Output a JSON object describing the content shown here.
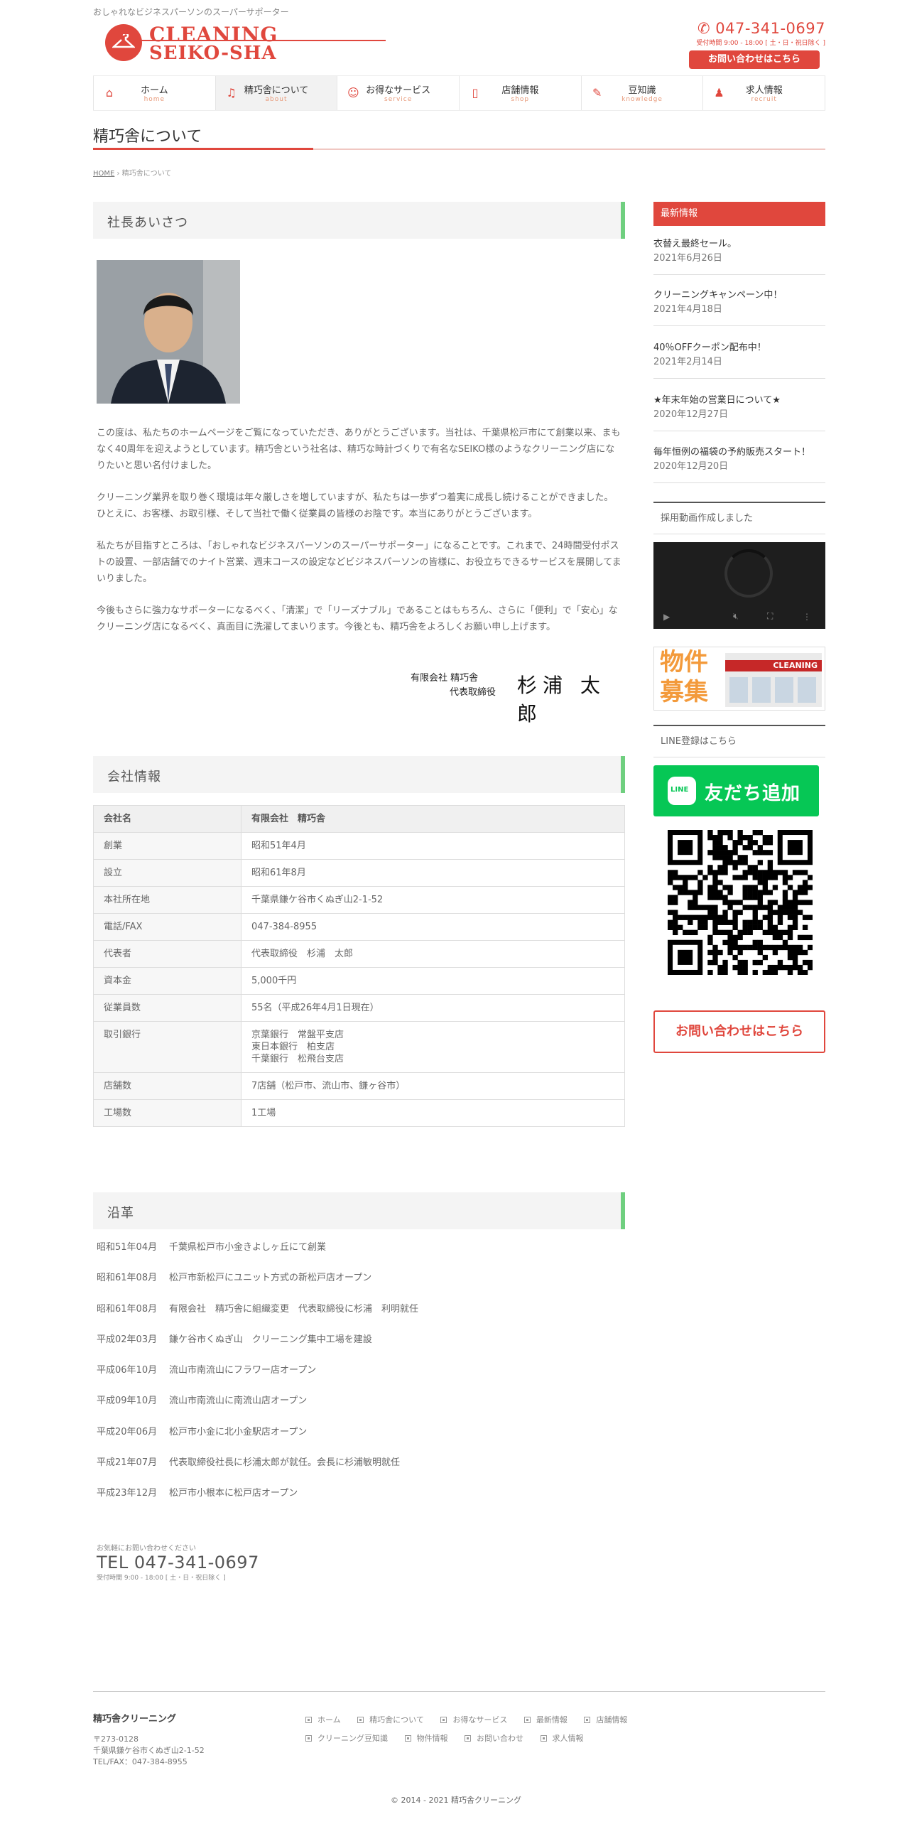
{
  "header": {
    "tagline": "おしゃれなビジネスパーソンのスーパーサポーター",
    "logo_line1": "CLEANING",
    "logo_line2": "SEIKO-SHA",
    "tel": "047-341-0697",
    "hours": "受付時間 9:00 - 18:00 [ 土・日・祝日除く ]",
    "contact_button": "お問い合わせはこちら"
  },
  "nav": {
    "items": [
      {
        "label": "ホーム",
        "sub": "home",
        "icon": "home-icon"
      },
      {
        "label": "精巧舎について",
        "sub": "about",
        "icon": "bell-icon"
      },
      {
        "label": "お得なサービス",
        "sub": "service",
        "icon": "smile-icon"
      },
      {
        "label": "店舗情報",
        "sub": "shop",
        "icon": "building-icon"
      },
      {
        "label": "豆知識",
        "sub": "knowledge",
        "icon": "edit-icon"
      },
      {
        "label": "求人情報",
        "sub": "recruit",
        "icon": "person-icon"
      }
    ]
  },
  "page": {
    "title": "精巧舎について",
    "breadcrumb_home": "HOME",
    "breadcrumb_sep": "›",
    "breadcrumb_current": "精巧舎について"
  },
  "greeting": {
    "heading": "社長あいさつ",
    "p1": "この度は、私たちのホームページをご覧になっていただき、ありがとうございます。当社は、千葉県松戸市にて創業以来、まもなく40周年を迎えようとしています。精巧舎という社名は、精巧な時計づくりで有名なSEIKO様のようなクリーニング店になりたいと思い名付けました。",
    "p2": "クリーニング業界を取り巻く環境は年々厳しさを増していますが、私たちは一歩ずつ着実に成長し続けることができました。ひとえに、お客様、お取引様、そして当社で働く従業員の皆様のお陰です。本当にありがとうございます。",
    "p3": "私たちが目指すところは、「おしゃれなビジネスパーソンのスーパーサポーター」になることです。これまで、24時間受付ポストの設置、一部店舗でのナイト営業、週末コースの設定などビジネスパーソンの皆様に、お役立ちできるサービスを展開してまいりました。",
    "p4": "今後もさらに強力なサポーターになるべく、「清潔」で「リーズナブル」であることはもちろん、さらに「便利」で「安心」なクリーニング店になるべく、真面目に洗濯してまいります。今後とも、精巧舎をよろしくお願い申し上げます。",
    "sig_company": "有限会社 精巧舎",
    "sig_title": "代表取締役",
    "sig_name": "杉浦 太郎"
  },
  "company": {
    "heading": "会社情報",
    "rows": [
      {
        "k": "会社名",
        "v": "有限会社　精巧舎"
      },
      {
        "k": "創業",
        "v": "昭和51年4月"
      },
      {
        "k": "設立",
        "v": "昭和61年8月"
      },
      {
        "k": "本社所在地",
        "v": "千葉県鎌ケ谷市くぬぎ山2-1-52"
      },
      {
        "k": "電話/FAX",
        "v": "047-384-8955"
      },
      {
        "k": "代表者",
        "v": "代表取締役　杉浦　太郎"
      },
      {
        "k": "資本金",
        "v": "5,000千円"
      },
      {
        "k": "従業員数",
        "v": "55名（平成26年4月1日現在）"
      },
      {
        "k": "取引銀行",
        "v1": "京葉銀行　常盤平支店",
        "v2": "東日本銀行　柏支店",
        "v3": "千葉銀行　松飛台支店"
      },
      {
        "k": "店舗数",
        "v": "7店舗（松戸市、流山市、鎌ヶ谷市）"
      },
      {
        "k": "工場数",
        "v": "1工場"
      }
    ]
  },
  "history": {
    "heading": "沿革",
    "items": [
      {
        "d": "昭和51年04月",
        "t": "千葉県松戸市小金きよしヶ丘にて創業"
      },
      {
        "d": "昭和61年08月",
        "t": "松戸市新松戸にユニット方式の新松戸店オープン"
      },
      {
        "d": "昭和61年08月",
        "t": "有限会社　精巧舎に組織変更　代表取締役に杉浦　利明就任"
      },
      {
        "d": "平成02年03月",
        "t": "鎌ケ谷市くぬぎ山　クリーニング集中工場を建設"
      },
      {
        "d": "平成06年10月",
        "t": "流山市南流山にフラワー店オープン"
      },
      {
        "d": "平成09年10月",
        "t": "流山市南流山に南流山店オープン"
      },
      {
        "d": "平成20年06月",
        "t": "松戸市小金に北小金駅店オープン"
      },
      {
        "d": "平成21年07月",
        "t": "代表取締役社長に杉浦太郎が就任。会長に杉浦敏明就任"
      },
      {
        "d": "平成23年12月",
        "t": "松戸市小根本に松戸店オープン"
      }
    ]
  },
  "bottom_contact": {
    "lead": "お気軽にお問い合わせください",
    "tel": "TEL 047-341-0697",
    "hours": "受付時間 9:00 - 18:00 [ 土・日・祝日除く ]"
  },
  "sidebar": {
    "news_heading": "最新情報",
    "news": [
      {
        "title": "衣替え最終セール。",
        "date": "2021年6月26日"
      },
      {
        "title": "クリーニングキャンペーン中！",
        "date": "2021年4月18日"
      },
      {
        "title": "40％OFFクーポン配布中！",
        "date": "2021年2月14日"
      },
      {
        "title": "★年末年始の営業日について★",
        "date": "2020年12月27日"
      },
      {
        "title": "毎年恒例の福袋の予約販売スタート！",
        "date": "2020年12月20日"
      }
    ],
    "video_heading": "採用動画作成しました",
    "banner_text": "物件募集",
    "banner_sign": "CLEANING",
    "line_heading": "LINE登録はこちら",
    "line_logo": "LINE",
    "line_button": "友だち追加",
    "contact_button": "お問い合わせはこちら"
  },
  "footer": {
    "company": "精巧舎クリーニング",
    "zip": "〒273-0128",
    "address": "千葉県鎌ケ谷市くぬぎ山2-1-52",
    "telfax": "TEL/FAX：047-384-8955",
    "links_row1": [
      "ホーム",
      "精巧舎について",
      "お得なサービス",
      "最新情報",
      "店舗情報"
    ],
    "links_row2": [
      "クリーニング豆知識",
      "物件情報",
      "お問い合わせ",
      "求人情報"
    ],
    "copyright": "© 2014 - 2021 精巧舎クリーニング"
  },
  "colors": {
    "accent": "#e0473d",
    "section_bar": "#6fcf7f",
    "line_green": "#06c755"
  }
}
